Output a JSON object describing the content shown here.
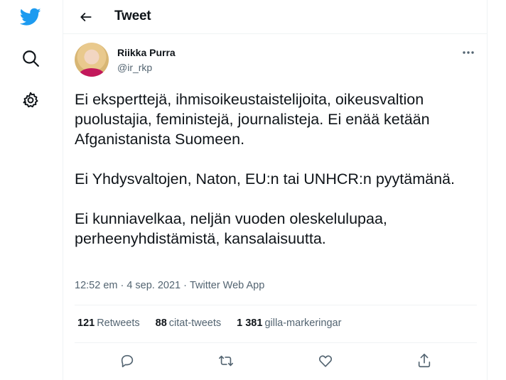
{
  "header": {
    "title": "Tweet"
  },
  "icons": {
    "brand": "twitter-bird-icon",
    "explore": "search-icon",
    "settings": "gear-icon",
    "back": "back-arrow-icon",
    "more": "more-dots-icon",
    "reply": "reply-icon",
    "retweet": "retweet-icon",
    "like": "heart-icon",
    "share": "share-icon"
  },
  "colors": {
    "brand": "#1d9bf0",
    "text": "#0f1419",
    "muted": "#536471",
    "border": "#eff3f4"
  },
  "tweet": {
    "author": {
      "name": "Riikka Purra",
      "handle": "@ir_rkp"
    },
    "paragraphs": [
      "Ei eksperttejä, ihmisoikeustaistelijoita, oikeusvaltion puolustajia, feministejä, journalisteja. Ei enää ketään Afganistanista Suomeen.",
      "Ei Yhdysvaltojen, Naton, EU:n tai UNHCR:n pyytämänä.",
      "Ei kunniavelkaa, neljän vuoden oleskelulupaa, perheenyhdistämistä, kansalaisuutta."
    ],
    "time": "12:52 em",
    "date": "4 sep. 2021",
    "source": "Twitter Web App",
    "separator": "·",
    "stats": {
      "retweets": {
        "count": "121",
        "label": "Retweets"
      },
      "quotes": {
        "count": "88",
        "label": "citat-tweets"
      },
      "likes": {
        "count": "1 381",
        "label": "gilla-markeringar"
      }
    }
  }
}
